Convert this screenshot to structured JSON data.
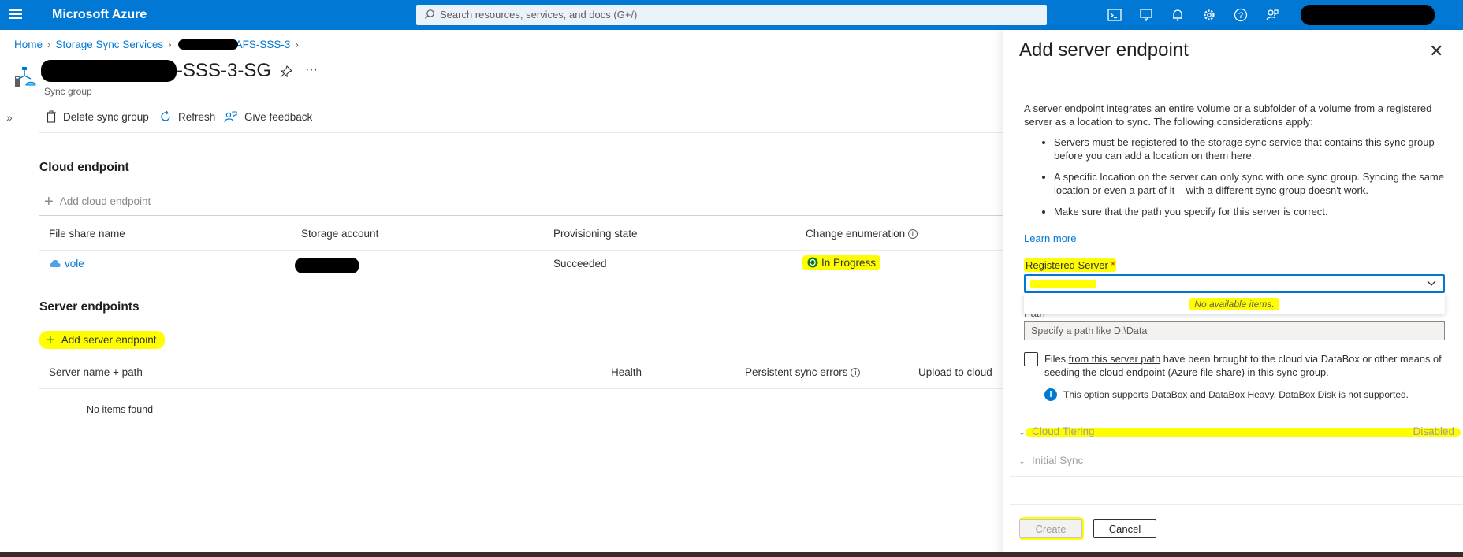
{
  "topbar": {
    "brand": "Microsoft Azure",
    "search_placeholder": "Search resources, services, and docs (G+/)",
    "icons": [
      "cloud-shell-icon",
      "directory-filter-icon",
      "bell-icon",
      "gear-icon",
      "help-icon",
      "feedback-icon"
    ]
  },
  "breadcrumb": {
    "home": "Home",
    "storage_sync": "Storage Sync Services",
    "current": "AFS-SSS-3"
  },
  "page": {
    "title_suffix": "-SSS-3-SG",
    "subtitle": "Sync group"
  },
  "commands": {
    "delete": "Delete sync group",
    "refresh": "Refresh",
    "feedback": "Give feedback"
  },
  "cloud_endpoint": {
    "title": "Cloud endpoint",
    "add_label": "Add cloud endpoint",
    "columns": [
      "File share name",
      "Storage account",
      "Provisioning state",
      "Change enumeration"
    ],
    "row": {
      "file_share": "vole",
      "provisioning_state": "Succeeded",
      "change_enumeration": "In Progress"
    }
  },
  "server_endpoints": {
    "title": "Server endpoints",
    "add_label": "Add server endpoint",
    "columns": [
      "Server name + path",
      "Health",
      "Persistent sync errors",
      "Upload to cloud"
    ],
    "empty_text": "No items found"
  },
  "panel": {
    "title": "Add server endpoint",
    "intro": "A server endpoint integrates an entire volume or a subfolder of a volume from a registered server as a location to sync. The following considerations apply:",
    "bullets": [
      "Servers must be registered to the storage sync service that contains this sync group before you can add a location on them here.",
      "A specific location on the server can only sync with one sync group. Syncing the same location or even a part of it – with a different sync group doesn't work.",
      "Make sure that the path you specify for this server is correct."
    ],
    "learn_more": "Learn more",
    "registered_server_label": "Registered Server",
    "required_mark": "*",
    "dropdown_empty": "No available items.",
    "path_label": "Path",
    "path_placeholder": "Specify a path like D:\\Data",
    "checkbox_text_1": "Files ",
    "checkbox_link": "from this server path",
    "checkbox_text_2": " have been brought to the cloud via DataBox or other means of seeding the cloud endpoint (Azure file share) in this sync group.",
    "info_note": "This option supports DataBox and DataBox Heavy. DataBox Disk is not supported.",
    "cloud_tiering_label": "Cloud Tiering",
    "cloud_tiering_value": "Disabled",
    "initial_sync_label": "Initial Sync",
    "create_label": "Create",
    "cancel_label": "Cancel"
  },
  "colors": {
    "azure_blue": "#0078d4",
    "highlight": "#fffe00",
    "status_green": "#107c10"
  }
}
